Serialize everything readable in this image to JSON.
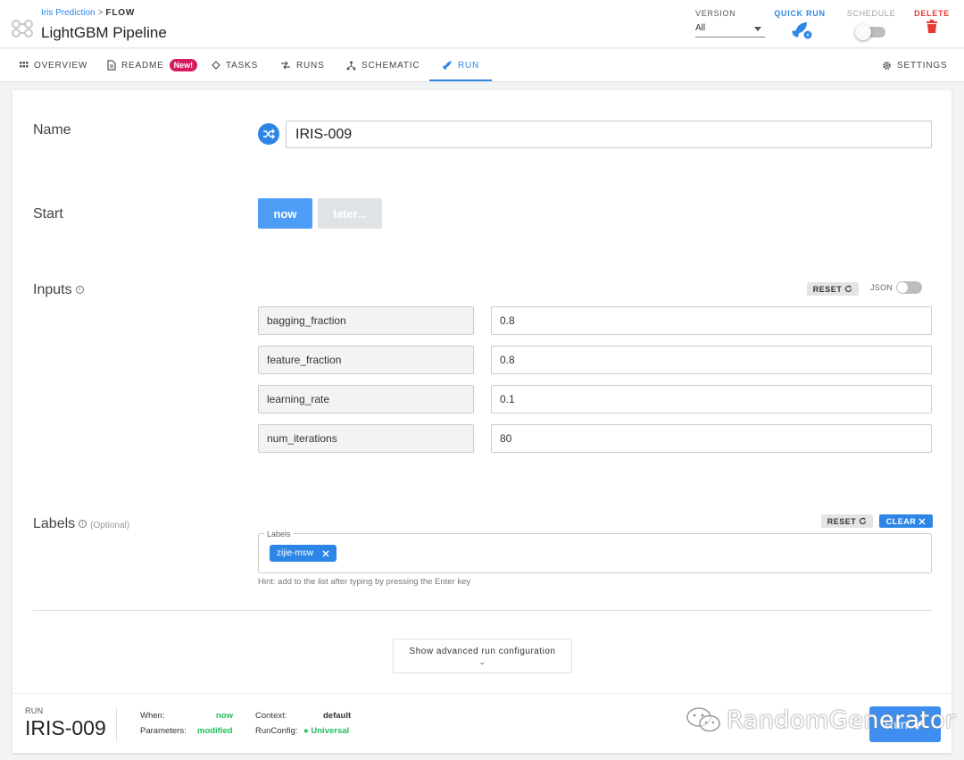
{
  "header": {
    "breadcrumb_link": "Iris Prediction",
    "breadcrumb_sep": ">",
    "breadcrumb_current": "FLOW",
    "title": "LightGBM Pipeline",
    "version_label": "VERSION",
    "version_value": "All",
    "quick_run_label": "QUICK RUN",
    "schedule_label": "SCHEDULE",
    "delete_label": "DELETE"
  },
  "tabs": [
    {
      "label": "OVERVIEW",
      "icon": "grid-icon"
    },
    {
      "label": "README",
      "icon": "document-icon",
      "badge": "New!"
    },
    {
      "label": "TASKS",
      "icon": "task-icon"
    },
    {
      "label": "RUNS",
      "icon": "runs-icon"
    },
    {
      "label": "SCHEMATIC",
      "icon": "schematic-icon"
    },
    {
      "label": "RUN",
      "icon": "rocket-icon",
      "active": true
    }
  ],
  "settings_label": "SETTINGS",
  "form": {
    "name_label": "Name",
    "name_value": "IRIS-009",
    "start_label": "Start",
    "start_now": "now",
    "start_later": "later...",
    "inputs_label": "Inputs",
    "inputs_reset": "RESET",
    "json_label": "JSON",
    "params": [
      {
        "key": "bagging_fraction",
        "value": "0.8"
      },
      {
        "key": "feature_fraction",
        "value": "0.8"
      },
      {
        "key": "learning_rate",
        "value": "0.1"
      },
      {
        "key": "num_iterations",
        "value": "80"
      }
    ],
    "labels_label": "Labels",
    "labels_optional": "(Optional)",
    "labels_reset": "RESET",
    "labels_clear": "CLEAR",
    "labels_legend": "Labels",
    "labels_chip": "zijie-msw",
    "labels_hint": "Hint: add to the list after typing by pressing the Enter key",
    "advanced": "Show advanced run configuration"
  },
  "footer": {
    "run_caption": "RUN",
    "run_id": "IRIS-009",
    "when_label": "When:",
    "when_value": "now",
    "params_label": "Parameters:",
    "params_value": "modified",
    "context_label": "Context:",
    "context_value": "default",
    "runconfig_label": "RunConfig:",
    "runconfig_value": "Universal",
    "run_button": "Run"
  },
  "watermark": "RandomGenerator",
  "colors": {
    "accent": "#2d86e6",
    "delete": "#e53935",
    "badge": "#d81b60",
    "success": "#1fbf5b"
  }
}
